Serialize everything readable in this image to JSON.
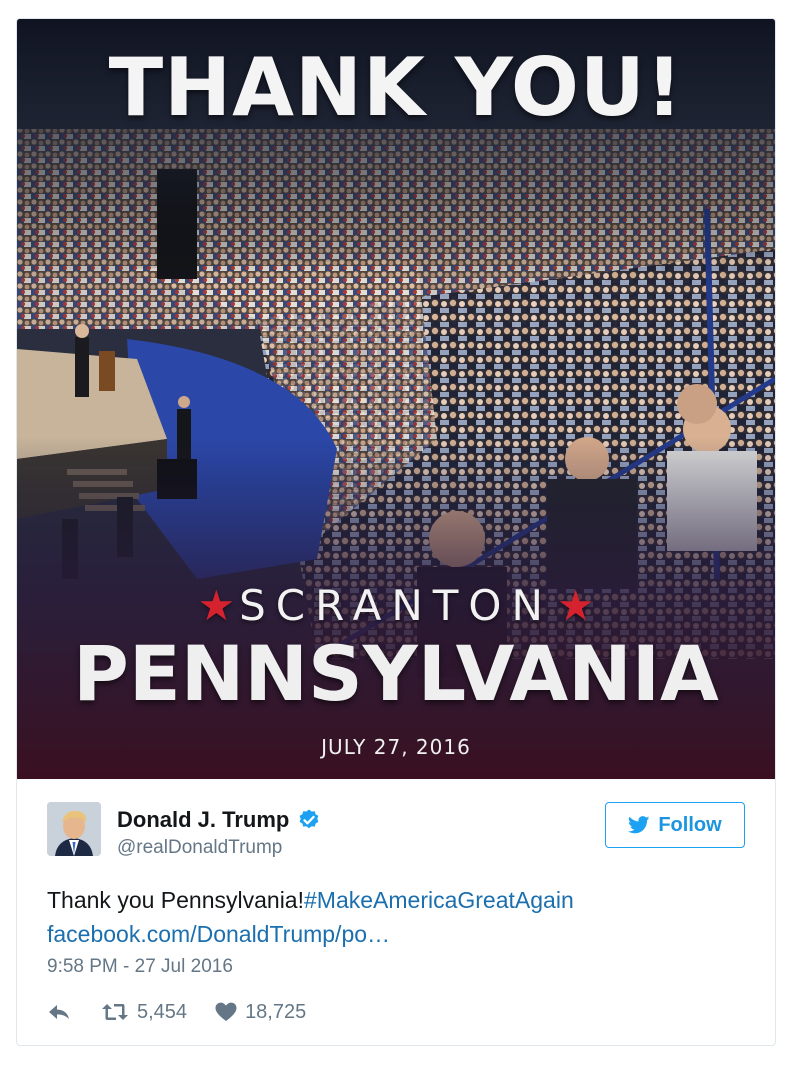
{
  "image": {
    "headline": "THANK YOU!",
    "city": "SCRANTON",
    "state": "PENNSYLVANIA",
    "date": "JULY 27, 2016",
    "star_color": "#d4232e"
  },
  "tweet": {
    "author_name": "Donald J. Trump",
    "handle": "@realDonaldTrump",
    "verified_icon": "verified-badge-icon",
    "follow_label": "Follow",
    "text_plain": "Thank you Pennsylvania!",
    "hashtag": "#MakeAmericaGreatAgain",
    "link": "facebook.com/DonaldTrump/po…",
    "timestamp": "9:58 PM - 27 Jul 2016",
    "retweet_count": "5,454",
    "like_count": "18,725"
  },
  "colors": {
    "accent": "#1da1f2",
    "link": "#1b6fae",
    "muted": "#657786",
    "text": "#14171a"
  }
}
